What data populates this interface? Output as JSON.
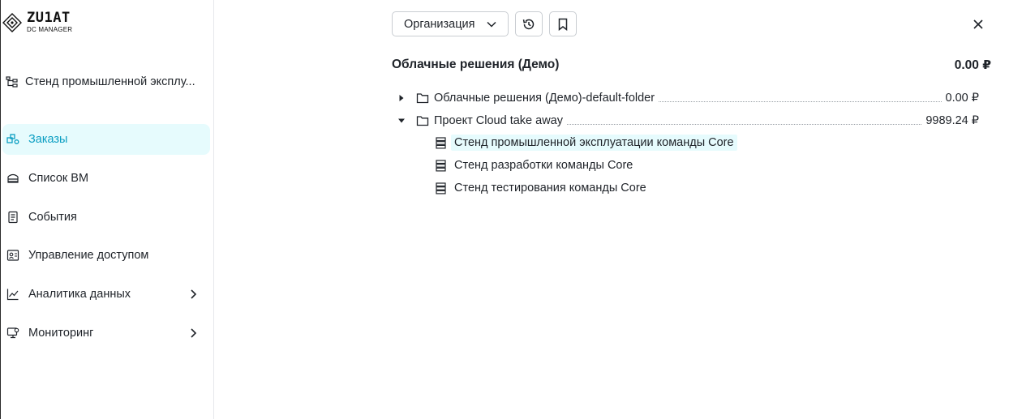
{
  "app": {
    "logo_main": "ZU1AT",
    "logo_sub": "DC MANAGER"
  },
  "sidebar": {
    "context_label": "Стенд промышленной эксплу...",
    "items": [
      {
        "label": "Заказы",
        "icon": "orders-icon",
        "active": true
      },
      {
        "label": "Список ВМ",
        "icon": "vm-list-icon"
      },
      {
        "label": "События",
        "icon": "events-icon"
      },
      {
        "label": "Управление доступом",
        "icon": "access-icon"
      },
      {
        "label": "Аналитика данных",
        "icon": "analytics-icon",
        "has_submenu": true
      },
      {
        "label": "Мониторинг",
        "icon": "monitoring-icon",
        "has_submenu": true
      }
    ]
  },
  "toolbar": {
    "org_select_value": "Организация",
    "history_icon": "history-icon",
    "bookmark_icon": "bookmark-icon",
    "close_icon": "close-icon"
  },
  "main": {
    "title": "Облачные решения (Демо)",
    "total": "0.00 ₽",
    "tree": [
      {
        "label": "Облачные решения (Демо)-default-folder",
        "amount": "0.00 ₽",
        "expanded": false
      },
      {
        "label": "Проект Cloud take away",
        "amount": "9989.24 ₽",
        "expanded": true,
        "children": [
          {
            "label": "Стенд промышленной эксплуатации команды Core",
            "selected": true
          },
          {
            "label": "Стенд разработки команды Core"
          },
          {
            "label": "Стенд тестирования команды Core"
          }
        ]
      }
    ]
  },
  "colors": {
    "accent": "#0a9ec2",
    "active_bg": "#e6fbfd",
    "text": "#1f2329"
  }
}
